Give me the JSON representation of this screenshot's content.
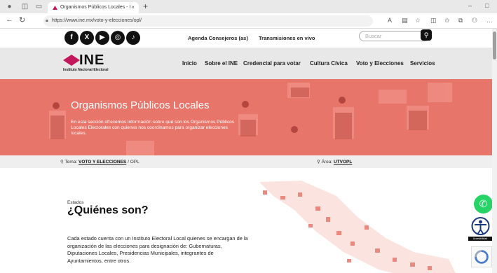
{
  "browser": {
    "tab_title": "Organismos Públicos Locales - I",
    "tab_close": "×",
    "new_tab": "+",
    "url": "https://www.ine.mx/voto-y-elecciones/opl/",
    "minimize": "–",
    "restore": "□"
  },
  "topbar": {
    "social": [
      "f",
      "X",
      "▶",
      "◎",
      "♪"
    ],
    "links": [
      "Agenda Consejeros (as)",
      "Transmisiones en vivo"
    ],
    "search_placeholder": "Buscar"
  },
  "logo": {
    "name": "INE",
    "subtitle": "Instituto Nacional Electoral"
  },
  "nav": {
    "items": [
      "Inicio",
      "Sobre el INE",
      "Credencial para votar",
      "Cultura Cívica",
      "Voto y Elecciones",
      "Servicios"
    ]
  },
  "hero": {
    "title": "Organismos Públicos Locales",
    "description": "En esta sección ofrecemos información sobre qué son los Organismos Públicos Locales Electorales con quienes nos coordinamos para organizar elecciones locales.",
    "color": "#e8756a"
  },
  "meta": {
    "tema_label": "Tema:",
    "tema_link": "VOTO Y ELECCIONES",
    "tema_rest": "/ OPL",
    "area_label": "Área:",
    "area_link": "UTVOPL"
  },
  "content": {
    "eyebrow": "Estados",
    "heading": "¿Quiénes son?",
    "paragraph": "Cada estado cuenta con un Instituto Electoral Local quienes se encargan de la organización de las elecciones para designación de: Gubernaturas, Diputaciones Locales, Presidencias Municipales, integrantes de Ayuntamientos, entre otros."
  },
  "floating": {
    "accessibility_label": "Accesibilidad"
  }
}
